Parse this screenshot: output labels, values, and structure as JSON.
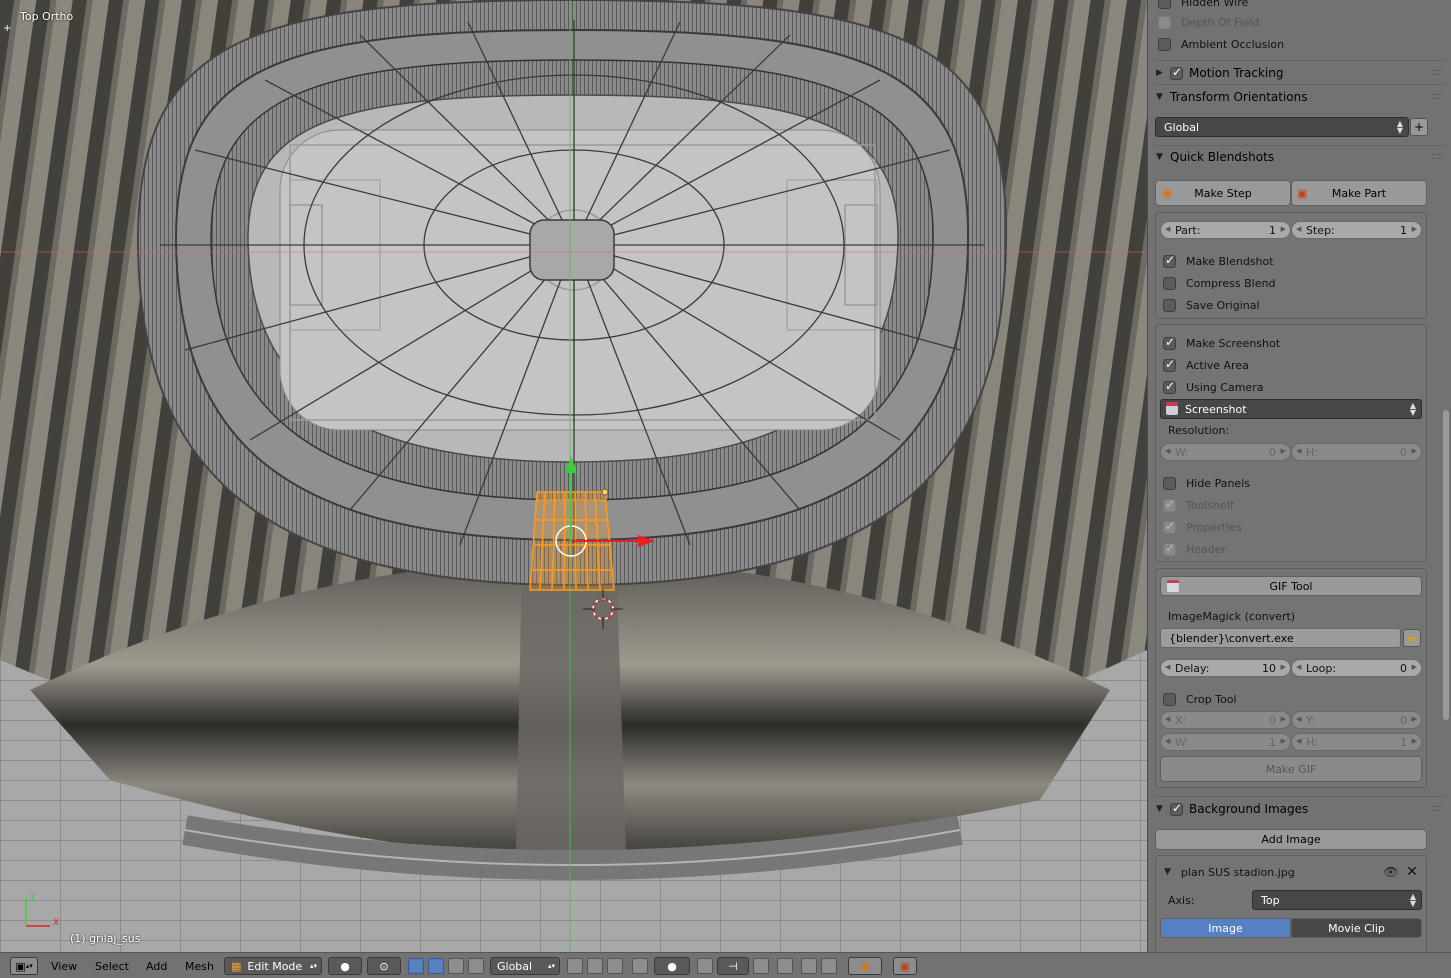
{
  "viewport": {
    "view_name": "Top Ortho",
    "object_name": "(1) grilaj_sus",
    "axis_x": "X",
    "axis_y": "Y"
  },
  "panel": {
    "top_items": [
      {
        "label": "Hidden Wire",
        "checked": false,
        "dim": false
      },
      {
        "label": "Depth Of Field",
        "checked": false,
        "dim": true
      },
      {
        "label": "Ambient Occlusion",
        "checked": false,
        "dim": false
      }
    ],
    "motion_tracking": {
      "label": "Motion Tracking",
      "checked": true
    },
    "transform_orientations": {
      "label": "Transform Orientations",
      "value": "Global"
    },
    "quick_blendshots": {
      "label": "Quick Blendshots",
      "make_step": "Make Step",
      "make_part": "Make Part",
      "part_label": "Part:",
      "part_value": "1",
      "step_label": "Step:",
      "step_value": "1",
      "make_blendshot": "Make Blendshot",
      "compress_blend": "Compress Blend",
      "save_original": "Save Original",
      "make_screenshot": "Make Screenshot",
      "active_area": "Active Area",
      "using_camera": "Using Camera",
      "screenshot_select": "Screenshot",
      "resolution": "Resolution:",
      "w_label": "W:",
      "w_value": "0",
      "h_label": "H:",
      "h_value": "0",
      "hide_panels": "Hide Panels",
      "toolshelf": "Toolshelf",
      "properties": "Properties",
      "header": "Header",
      "gif_tool": "GIF Tool",
      "imagemagick_label": "ImageMagick (convert)",
      "imagemagick_path": "{blender}\\convert.exe",
      "delay_label": "Delay:",
      "delay_value": "10",
      "loop_label": "Loop:",
      "loop_value": "0",
      "crop_tool": "Crop Tool",
      "crop_x_label": "X:",
      "crop_x_value": "0",
      "crop_y_label": "Y:",
      "crop_y_value": "0",
      "crop_w_label": "W:",
      "crop_w_value": "1",
      "crop_h_label": "H:",
      "crop_h_value": "1",
      "make_gif": "Make GIF"
    },
    "background_images": {
      "label": "Background Images",
      "checked": true,
      "add_image": "Add Image",
      "image_name": "plan SUS stadion.jpg",
      "axis_label": "Axis:",
      "axis_value": "Top",
      "tab_image": "Image",
      "tab_movie_clip": "Movie Clip"
    }
  },
  "header": {
    "menu_view": "View",
    "menu_select": "Select",
    "menu_add": "Add",
    "menu_mesh": "Mesh",
    "mode": "Edit Mode",
    "orientation": "Global"
  },
  "colors": {
    "selection_orange": "#ff9a1a",
    "axis_green": "#3ccf3c",
    "axis_red": "#e82020",
    "active_blue": "#5680c2"
  }
}
